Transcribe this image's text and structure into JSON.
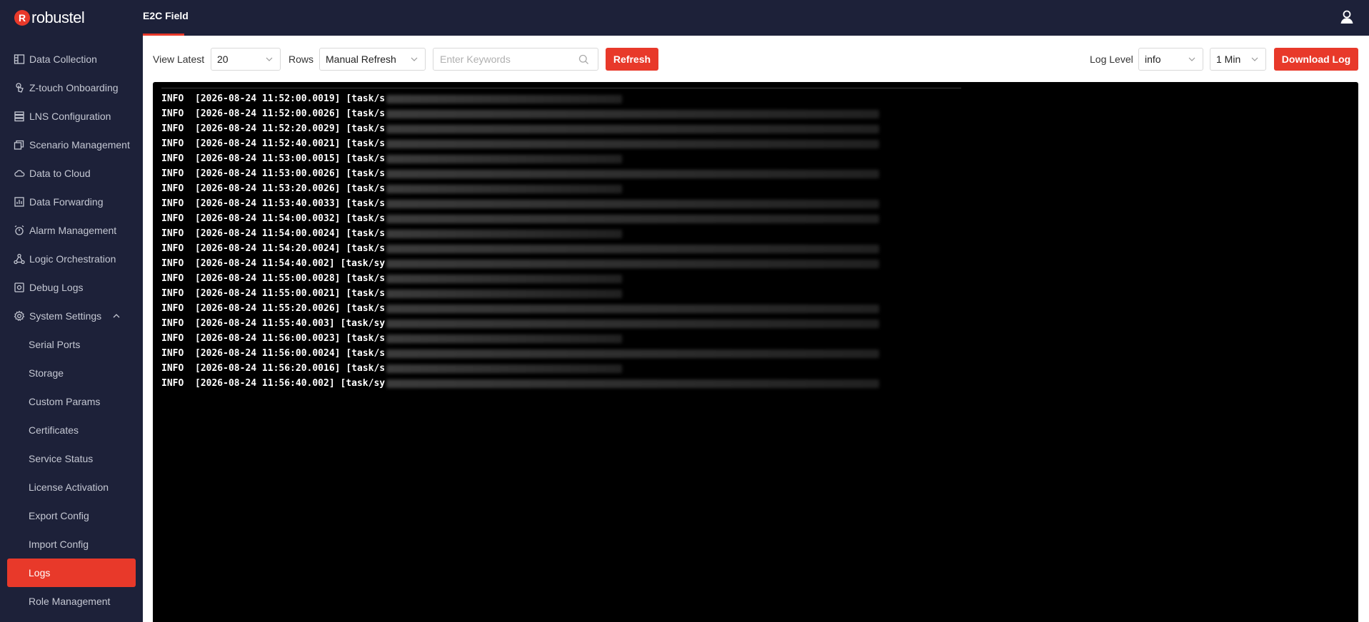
{
  "app": {
    "logo_text": "robustel",
    "top_tab": "E2C Field"
  },
  "sidebar": {
    "items": [
      {
        "label": "Data Collection",
        "icon": "data-collection-icon"
      },
      {
        "label": "Z-touch Onboarding",
        "icon": "touch-icon"
      },
      {
        "label": "LNS Configuration",
        "icon": "server-icon"
      },
      {
        "label": "Scenario Management",
        "icon": "layers-icon"
      },
      {
        "label": "Data to Cloud",
        "icon": "cloud-icon"
      },
      {
        "label": "Data Forwarding",
        "icon": "forward-icon"
      },
      {
        "label": "Alarm Management",
        "icon": "alarm-icon"
      },
      {
        "label": "Logic Orchestration",
        "icon": "flow-icon"
      },
      {
        "label": "Debug Logs",
        "icon": "debug-icon"
      },
      {
        "label": "System Settings",
        "icon": "gear-icon"
      }
    ],
    "sub_items": [
      {
        "label": "Serial Ports"
      },
      {
        "label": "Storage"
      },
      {
        "label": "Custom Params"
      },
      {
        "label": "Certificates"
      },
      {
        "label": "Service Status"
      },
      {
        "label": "License Activation"
      },
      {
        "label": "Export Config"
      },
      {
        "label": "Import Config"
      },
      {
        "label": "Logs"
      },
      {
        "label": "Role Management"
      }
    ],
    "active_item": "Logs"
  },
  "toolbar": {
    "view_latest_label": "View Latest",
    "rows_value": "20",
    "rows_label": "Rows",
    "refresh_mode": "Manual Refresh",
    "search_placeholder": "Enter Keywords",
    "search_value": "",
    "refresh_button": "Refresh",
    "log_level_label": "Log Level",
    "log_level_value": "info",
    "interval_value": "1 Min",
    "download_button": "Download Log"
  },
  "colors": {
    "accent": "#e8392a",
    "nav_bg": "#1d2139",
    "console_bg": "#000000"
  },
  "logs": [
    {
      "level": "INFO",
      "timestamp": "[2026-08-24 11:52:00.0019]",
      "task": "[task/s"
    },
    {
      "level": "INFO",
      "timestamp": "[2026-08-24 11:52:00.0026]",
      "task": "[task/s"
    },
    {
      "level": "INFO",
      "timestamp": "[2026-08-24 11:52:20.0029]",
      "task": "[task/s"
    },
    {
      "level": "INFO",
      "timestamp": "[2026-08-24 11:52:40.0021]",
      "task": "[task/s"
    },
    {
      "level": "INFO",
      "timestamp": "[2026-08-24 11:53:00.0015]",
      "task": "[task/s"
    },
    {
      "level": "INFO",
      "timestamp": "[2026-08-24 11:53:00.0026]",
      "task": "[task/s"
    },
    {
      "level": "INFO",
      "timestamp": "[2026-08-24 11:53:20.0026]",
      "task": "[task/s"
    },
    {
      "level": "INFO",
      "timestamp": "[2026-08-24 11:53:40.0033]",
      "task": "[task/s"
    },
    {
      "level": "INFO",
      "timestamp": "[2026-08-24 11:54:00.0032]",
      "task": "[task/s"
    },
    {
      "level": "INFO",
      "timestamp": "[2026-08-24 11:54:00.0024]",
      "task": "[task/s"
    },
    {
      "level": "INFO",
      "timestamp": "[2026-08-24 11:54:20.0024]",
      "task": "[task/s"
    },
    {
      "level": "INFO",
      "timestamp": "[2026-08-24 11:54:40.002]",
      "task": "[task/sy"
    },
    {
      "level": "INFO",
      "timestamp": "[2026-08-24 11:55:00.0028]",
      "task": "[task/s"
    },
    {
      "level": "INFO",
      "timestamp": "[2026-08-24 11:55:00.0021]",
      "task": "[task/s"
    },
    {
      "level": "INFO",
      "timestamp": "[2026-08-24 11:55:20.0026]",
      "task": "[task/s"
    },
    {
      "level": "INFO",
      "timestamp": "[2026-08-24 11:55:40.003]",
      "task": "[task/sy"
    },
    {
      "level": "INFO",
      "timestamp": "[2026-08-24 11:56:00.0023]",
      "task": "[task/s"
    },
    {
      "level": "INFO",
      "timestamp": "[2026-08-24 11:56:00.0024]",
      "task": "[task/s"
    },
    {
      "level": "INFO",
      "timestamp": "[2026-08-24 11:56:20.0016]",
      "task": "[task/s"
    },
    {
      "level": "INFO",
      "timestamp": "[2026-08-24 11:56:40.002]",
      "task": "[task/sy"
    }
  ]
}
